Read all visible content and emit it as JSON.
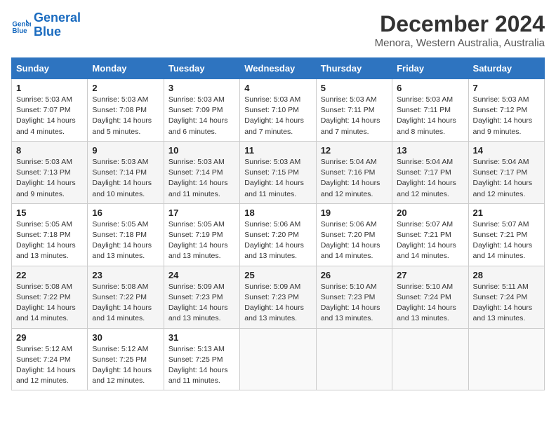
{
  "header": {
    "logo_line1": "General",
    "logo_line2": "Blue",
    "month_year": "December 2024",
    "location": "Menora, Western Australia, Australia"
  },
  "days_of_week": [
    "Sunday",
    "Monday",
    "Tuesday",
    "Wednesday",
    "Thursday",
    "Friday",
    "Saturday"
  ],
  "weeks": [
    [
      {
        "day": "1",
        "sunrise": "5:03 AM",
        "sunset": "7:07 PM",
        "daylight": "14 hours and 4 minutes."
      },
      {
        "day": "2",
        "sunrise": "5:03 AM",
        "sunset": "7:08 PM",
        "daylight": "14 hours and 5 minutes."
      },
      {
        "day": "3",
        "sunrise": "5:03 AM",
        "sunset": "7:09 PM",
        "daylight": "14 hours and 6 minutes."
      },
      {
        "day": "4",
        "sunrise": "5:03 AM",
        "sunset": "7:10 PM",
        "daylight": "14 hours and 7 minutes."
      },
      {
        "day": "5",
        "sunrise": "5:03 AM",
        "sunset": "7:11 PM",
        "daylight": "14 hours and 7 minutes."
      },
      {
        "day": "6",
        "sunrise": "5:03 AM",
        "sunset": "7:11 PM",
        "daylight": "14 hours and 8 minutes."
      },
      {
        "day": "7",
        "sunrise": "5:03 AM",
        "sunset": "7:12 PM",
        "daylight": "14 hours and 9 minutes."
      }
    ],
    [
      {
        "day": "8",
        "sunrise": "5:03 AM",
        "sunset": "7:13 PM",
        "daylight": "14 hours and 9 minutes."
      },
      {
        "day": "9",
        "sunrise": "5:03 AM",
        "sunset": "7:14 PM",
        "daylight": "14 hours and 10 minutes."
      },
      {
        "day": "10",
        "sunrise": "5:03 AM",
        "sunset": "7:14 PM",
        "daylight": "14 hours and 11 minutes."
      },
      {
        "day": "11",
        "sunrise": "5:03 AM",
        "sunset": "7:15 PM",
        "daylight": "14 hours and 11 minutes."
      },
      {
        "day": "12",
        "sunrise": "5:04 AM",
        "sunset": "7:16 PM",
        "daylight": "14 hours and 12 minutes."
      },
      {
        "day": "13",
        "sunrise": "5:04 AM",
        "sunset": "7:17 PM",
        "daylight": "14 hours and 12 minutes."
      },
      {
        "day": "14",
        "sunrise": "5:04 AM",
        "sunset": "7:17 PM",
        "daylight": "14 hours and 12 minutes."
      }
    ],
    [
      {
        "day": "15",
        "sunrise": "5:05 AM",
        "sunset": "7:18 PM",
        "daylight": "14 hours and 13 minutes."
      },
      {
        "day": "16",
        "sunrise": "5:05 AM",
        "sunset": "7:18 PM",
        "daylight": "14 hours and 13 minutes."
      },
      {
        "day": "17",
        "sunrise": "5:05 AM",
        "sunset": "7:19 PM",
        "daylight": "14 hours and 13 minutes."
      },
      {
        "day": "18",
        "sunrise": "5:06 AM",
        "sunset": "7:20 PM",
        "daylight": "14 hours and 13 minutes."
      },
      {
        "day": "19",
        "sunrise": "5:06 AM",
        "sunset": "7:20 PM",
        "daylight": "14 hours and 14 minutes."
      },
      {
        "day": "20",
        "sunrise": "5:07 AM",
        "sunset": "7:21 PM",
        "daylight": "14 hours and 14 minutes."
      },
      {
        "day": "21",
        "sunrise": "5:07 AM",
        "sunset": "7:21 PM",
        "daylight": "14 hours and 14 minutes."
      }
    ],
    [
      {
        "day": "22",
        "sunrise": "5:08 AM",
        "sunset": "7:22 PM",
        "daylight": "14 hours and 14 minutes."
      },
      {
        "day": "23",
        "sunrise": "5:08 AM",
        "sunset": "7:22 PM",
        "daylight": "14 hours and 14 minutes."
      },
      {
        "day": "24",
        "sunrise": "5:09 AM",
        "sunset": "7:23 PM",
        "daylight": "14 hours and 13 minutes."
      },
      {
        "day": "25",
        "sunrise": "5:09 AM",
        "sunset": "7:23 PM",
        "daylight": "14 hours and 13 minutes."
      },
      {
        "day": "26",
        "sunrise": "5:10 AM",
        "sunset": "7:23 PM",
        "daylight": "14 hours and 13 minutes."
      },
      {
        "day": "27",
        "sunrise": "5:10 AM",
        "sunset": "7:24 PM",
        "daylight": "14 hours and 13 minutes."
      },
      {
        "day": "28",
        "sunrise": "5:11 AM",
        "sunset": "7:24 PM",
        "daylight": "14 hours and 13 minutes."
      }
    ],
    [
      {
        "day": "29",
        "sunrise": "5:12 AM",
        "sunset": "7:24 PM",
        "daylight": "14 hours and 12 minutes."
      },
      {
        "day": "30",
        "sunrise": "5:12 AM",
        "sunset": "7:25 PM",
        "daylight": "14 hours and 12 minutes."
      },
      {
        "day": "31",
        "sunrise": "5:13 AM",
        "sunset": "7:25 PM",
        "daylight": "14 hours and 11 minutes."
      },
      null,
      null,
      null,
      null
    ]
  ],
  "labels": {
    "sunrise": "Sunrise:",
    "sunset": "Sunset:",
    "daylight": "Daylight:"
  }
}
